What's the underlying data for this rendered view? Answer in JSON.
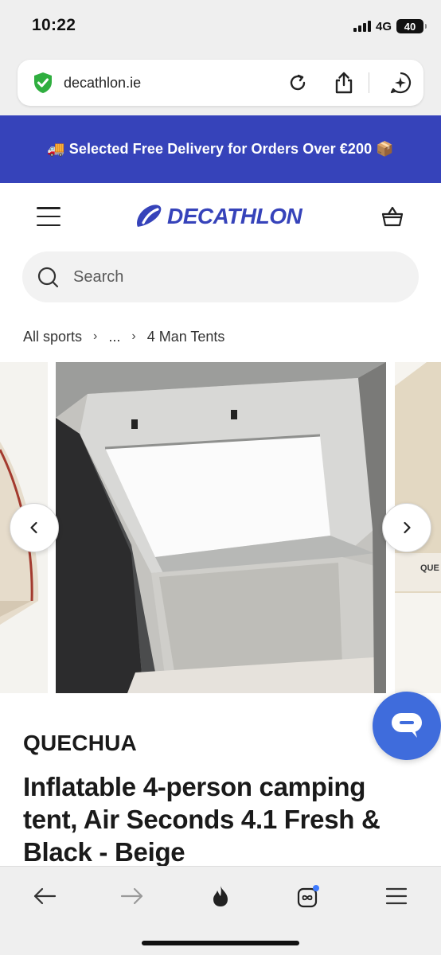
{
  "status_bar": {
    "time": "10:22",
    "network": "4G",
    "battery": "40"
  },
  "browser": {
    "url": "decathlon.ie"
  },
  "promo": {
    "text": "🚚 Selected Free Delivery for Orders Over €200 📦"
  },
  "header": {
    "logo_text": "DECATHLON"
  },
  "search": {
    "placeholder": "Search"
  },
  "breadcrumb": {
    "items": [
      "All sports",
      "...",
      "4 Man Tents"
    ]
  },
  "product": {
    "brand": "QUECHUA",
    "title": "Inflatable 4-person camping tent, Air Seconds 4.1 Fresh & Black - Beige"
  },
  "colors": {
    "brand_blue": "#3643ba",
    "chat_blue": "#3f6cdc",
    "shield_green": "#2fae3f"
  },
  "icons": [
    "shield-check",
    "reload",
    "share",
    "assistant-sparkle",
    "menu",
    "cart",
    "search",
    "chevron-left",
    "chevron-right",
    "chat",
    "back-arrow",
    "forward-arrow",
    "flame",
    "tabs",
    "hamburger"
  ]
}
